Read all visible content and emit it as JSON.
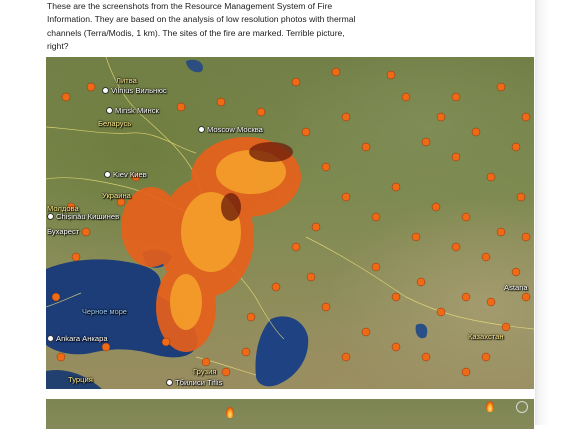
{
  "intro_text": "These are the screenshots from the Resource Management System of Fire Information. They are based on the analysis of low resolution photos with thermal channels (Terra/Modis, 1 km). The sites of the fire are marked. Terrible picture, right?",
  "map": {
    "labels": {
      "litva": "Литва",
      "vilnius": "Vilnius Вильнюс",
      "minsk": "Minsk Минск",
      "belarus": "Беларусь",
      "moscow": "Moscow Москва",
      "kiev": "Kiev Киев",
      "ukraine": "Украина",
      "moldova": "Молдова",
      "chisinau": "Chișinău Кишинев",
      "bucharest": "Бухарест",
      "black_sea": "Черное море",
      "ankara": "Ankara Анкара",
      "turkey": "Турция",
      "georgia": "Грузия",
      "tbilisi": "Тбилиси Tiflis",
      "kazakhstan": "Казахстан",
      "astana": "Astana"
    }
  },
  "colors": {
    "fire": "#e85a12",
    "water": "#1d3d78",
    "land": "#7d8a50",
    "country_label": "#ffeb8a"
  }
}
